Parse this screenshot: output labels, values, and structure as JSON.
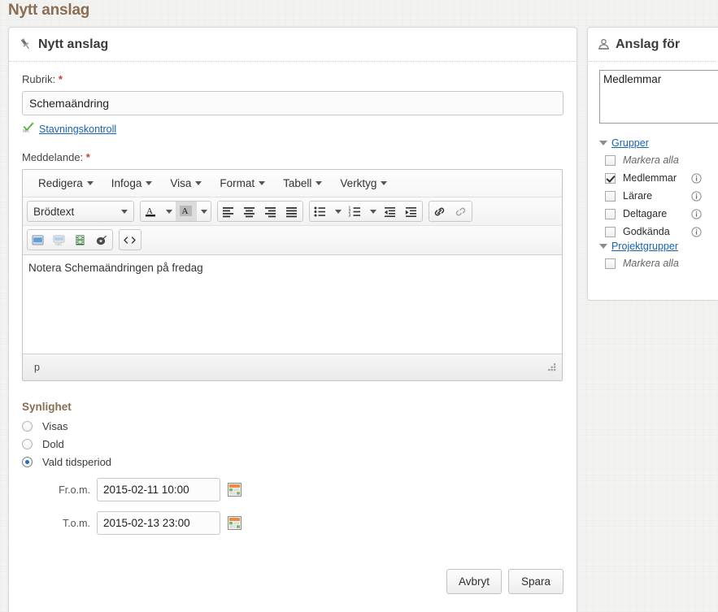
{
  "page": {
    "title": "Nytt anslag"
  },
  "main_panel": {
    "header": {
      "icon": "pin-icon",
      "title": "Nytt anslag"
    },
    "rubrik": {
      "label": "Rubrik:",
      "required_marker": "*",
      "value": "Schemaändring",
      "placeholder": ""
    },
    "spellcheck": {
      "icon": "spellcheck-icon",
      "link_label": "Stavningskontroll"
    },
    "meddelande": {
      "label": "Meddelande:",
      "required_marker": "*"
    },
    "editor": {
      "menus": [
        {
          "label": "Redigera",
          "icon": "chevron-down-icon"
        },
        {
          "label": "Infoga",
          "icon": "chevron-down-icon"
        },
        {
          "label": "Visa",
          "icon": "chevron-down-icon"
        },
        {
          "label": "Format",
          "icon": "chevron-down-icon"
        },
        {
          "label": "Tabell",
          "icon": "chevron-down-icon"
        },
        {
          "label": "Verktyg",
          "icon": "chevron-down-icon"
        }
      ],
      "style_select": {
        "value": "Brödtext",
        "icon": "chevron-down-icon"
      },
      "toolbar_icons": [
        "text-color-icon",
        "background-color-icon",
        "align-left-icon",
        "align-center-icon",
        "align-right-icon",
        "align-justify-icon",
        "bullet-list-icon",
        "numbered-list-icon",
        "outdent-icon",
        "indent-icon",
        "link-icon",
        "unlink-icon",
        "insert-image-icon",
        "spellcheck-toggle-icon",
        "insert-media-icon",
        "insert-audio-icon",
        "source-code-icon"
      ],
      "content": "Notera Schemaändringen på fredag",
      "statusbar_path": "p",
      "resize_handle": "resize-grip-icon"
    },
    "synlighet": {
      "title": "Synlighet",
      "options": [
        {
          "label": "Visas",
          "checked": false
        },
        {
          "label": "Dold",
          "checked": false
        },
        {
          "label": "Vald tidsperiod",
          "checked": true
        }
      ],
      "from": {
        "label": "Fr.o.m.",
        "value": "2015-02-11 10:00",
        "calendar_icon": "calendar-icon"
      },
      "to": {
        "label": "T.o.m.",
        "value": "2015-02-13 23:00",
        "calendar_icon": "calendar-icon"
      }
    },
    "footer": {
      "cancel_label": "Avbryt",
      "save_label": "Spara"
    }
  },
  "side_panel": {
    "header": {
      "icon": "user-icon",
      "title": "Anslag för"
    },
    "recipients_value": "Medlemmar",
    "groups": [
      {
        "group_label": "Grupper",
        "expanded": true,
        "items": [
          {
            "label": "Markera alla",
            "checked": false,
            "italic": true,
            "info": false
          },
          {
            "label": "Medlemmar",
            "checked": true,
            "italic": false,
            "info": true
          },
          {
            "label": "Lärare",
            "checked": false,
            "italic": false,
            "info": true
          },
          {
            "label": "Deltagare",
            "checked": false,
            "italic": false,
            "info": true
          },
          {
            "label": "Godkända",
            "checked": false,
            "italic": false,
            "info": true
          }
        ]
      },
      {
        "group_label": "Projektgrupper",
        "expanded": true,
        "items": [
          {
            "label": "Markera alla",
            "checked": false,
            "italic": true,
            "info": false
          }
        ]
      }
    ]
  },
  "colors": {
    "page_title": "#8a6d52",
    "section_title": "#8a6d52",
    "link": "#1763b5",
    "required": "#d0392b",
    "radio_accent": "#1a6fc4",
    "background": "#f2f2f1"
  }
}
